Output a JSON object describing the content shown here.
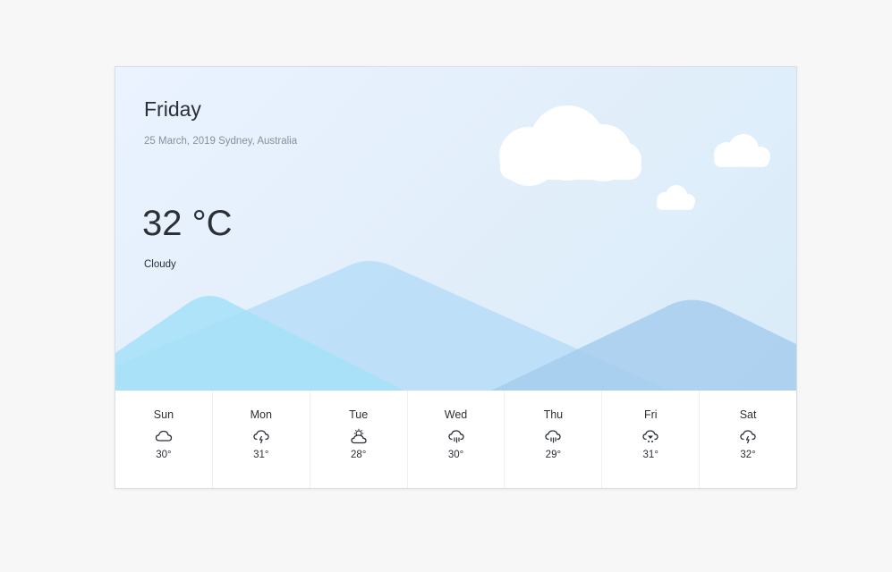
{
  "current": {
    "day": "Friday",
    "date_location": "25 March, 2019 Sydney, Australia",
    "temperature": "32 °C",
    "condition": "Cloudy"
  },
  "forecast": [
    {
      "day": "Sun",
      "temp": "30°",
      "icon": "cloud-icon"
    },
    {
      "day": "Mon",
      "temp": "31°",
      "icon": "cloud-lightning-icon"
    },
    {
      "day": "Tue",
      "temp": "28°",
      "icon": "cloud-sun-icon"
    },
    {
      "day": "Wed",
      "temp": "30°",
      "icon": "cloud-rain-icon"
    },
    {
      "day": "Thu",
      "temp": "29°",
      "icon": "cloud-rain-icon"
    },
    {
      "day": "Fri",
      "temp": "31°",
      "icon": "cloud-hail-icon"
    },
    {
      "day": "Sat",
      "temp": "32°",
      "icon": "cloud-lightning-icon"
    }
  ],
  "colors": {
    "sky_light": "#eaf3ff",
    "sky_dark": "#d8ecf8",
    "mountain_left": "#a9e3f8",
    "mountain_center": "#b7dcf6",
    "mountain_right": "#a8ccec",
    "text": "#2b2f36",
    "muted_text": "#8a8f99"
  }
}
